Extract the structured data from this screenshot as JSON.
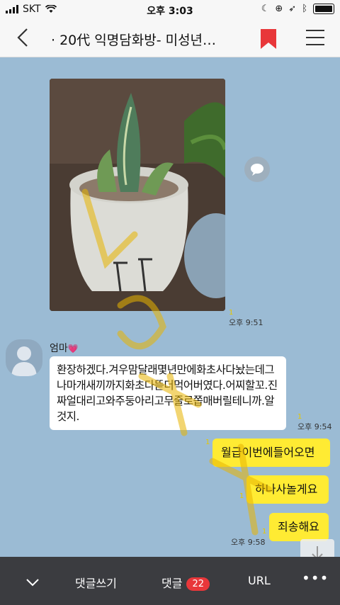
{
  "status_bar": {
    "carrier": "SKT",
    "time": "오후 3:03"
  },
  "nav": {
    "title": "· 20代 익명담화방- 미성년…"
  },
  "chat": {
    "photo_time": "오후 9:51",
    "photo_unread": "1",
    "sender_name": "엄마",
    "message_white": "환장하겠다.겨우맘달래몇년만에화초사다놨는데그나마개새끼까지화초다뜯더먹어버였다.어찌할꼬.진짜얼대리고와주둥아리고무줄로쫍매버릴테니까.알것지.",
    "message_white_unread": "1",
    "message_white_time": "오후 9:54",
    "replies": [
      {
        "text": "월급이번에들어오면",
        "unread": "1"
      },
      {
        "text": "하나사놀게요",
        "unread": "1"
      },
      {
        "text": "죄송해요",
        "unread": "1"
      }
    ],
    "reply_time": "오후 9:58"
  },
  "bottom_bar": {
    "write_comment": "댓글쓰기",
    "comments_label": "댓글",
    "comments_count": "22",
    "url_label": "URL"
  },
  "colors": {
    "chat_bg": "#9bbbd4",
    "yellow_bubble": "#ffeb33",
    "bookmark": "#e8373a",
    "bottom_bar": "#3b3c40"
  }
}
